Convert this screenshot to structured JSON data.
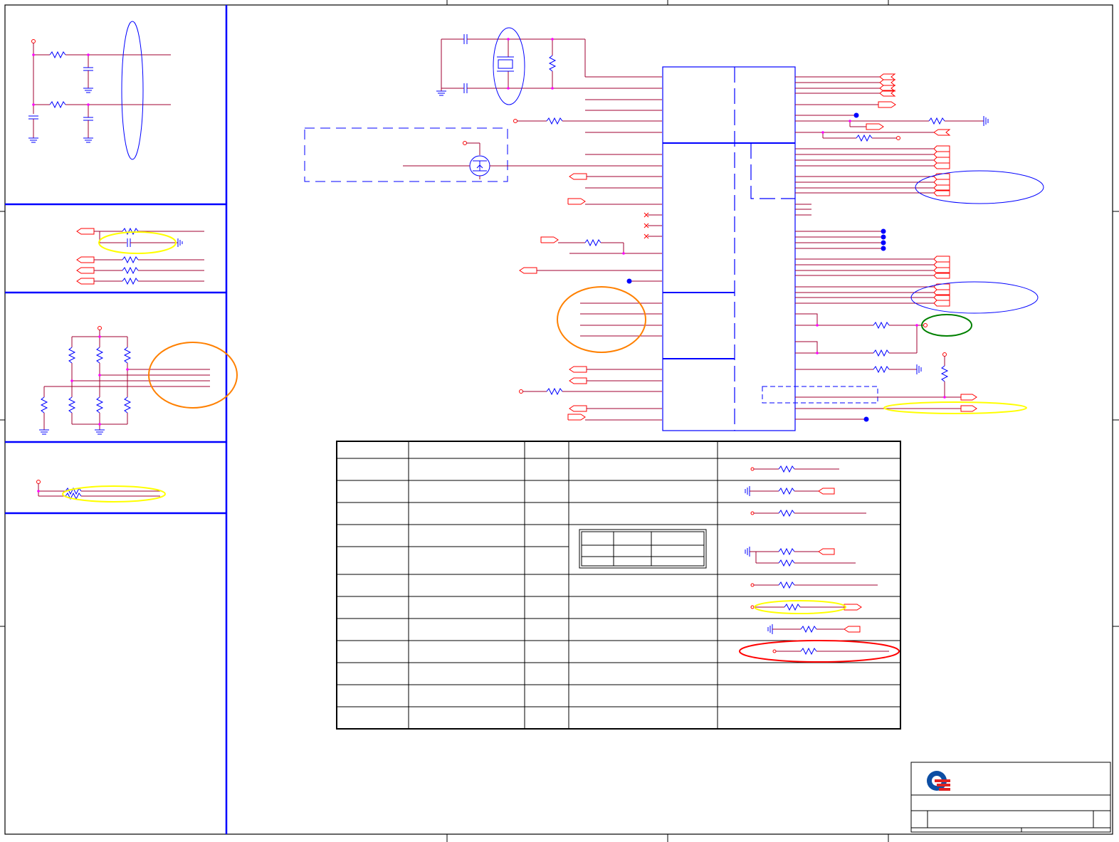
{
  "sheet": {
    "title_block": {
      "logo": "company-logo-icon",
      "cells": [
        "",
        "",
        "",
        ""
      ]
    }
  },
  "colors": {
    "frame": "#000000",
    "panel_border": "#0000ff",
    "wire": "#a00030",
    "pin": "#ff0000",
    "component": "#0000ff",
    "junction": "#ff00ff",
    "annotation_yellow": "#ffff00",
    "annotation_orange": "#ff8000",
    "annotation_blue": "#0000ff",
    "annotation_green": "#008000",
    "annotation_red": "#ff0000",
    "logo_blue": "#0d4ea3",
    "logo_red": "#e02020"
  },
  "panels": [
    "top-left-rc-filter-panel",
    "series-resistor-panel",
    "strap-resistor-panel",
    "pullup-panel"
  ],
  "annotations": [
    {
      "name": "crystal-highlight-ellipse",
      "color": "blue"
    },
    {
      "name": "filter-output-ellipse",
      "color": "blue"
    },
    {
      "name": "bypass-cap-ellipse",
      "color": "yellow"
    },
    {
      "name": "strap-lines-ellipse",
      "color": "orange"
    },
    {
      "name": "pullup-ellipse",
      "color": "yellow"
    },
    {
      "name": "ic-input-ellipse",
      "color": "orange"
    },
    {
      "name": "right-bus-ellipse-1",
      "color": "blue"
    },
    {
      "name": "right-bus-ellipse-2",
      "color": "blue"
    },
    {
      "name": "test-point-ellipse",
      "color": "green"
    },
    {
      "name": "output-port-ellipse",
      "color": "yellow"
    },
    {
      "name": "table-row-ellipse-yellow",
      "color": "yellow"
    },
    {
      "name": "table-row-ellipse-red",
      "color": "red"
    }
  ],
  "config_table": {
    "rows": 12,
    "columns": 5,
    "cells": []
  }
}
